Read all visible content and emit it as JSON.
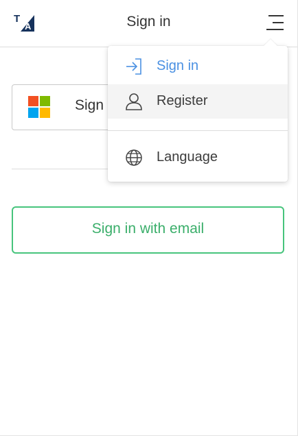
{
  "header": {
    "logo_text": "TA",
    "title": "Sign in",
    "menu_icon": "hamburger-menu-icon"
  },
  "main": {
    "microsoft_button": {
      "label": "Sign",
      "icon": "microsoft-logo-icon",
      "colors": [
        "#f25022",
        "#7fba00",
        "#00a4ef",
        "#ffb900"
      ]
    },
    "email_button": {
      "label": "Sign in with email",
      "color": "#3aae6a"
    }
  },
  "dropdown": {
    "items": [
      {
        "label": "Sign in",
        "icon": "sign-in-arrow-icon",
        "color": "#4a90e2"
      },
      {
        "label": "Register",
        "icon": "user-icon"
      },
      {
        "label": "Language",
        "icon": "globe-icon"
      }
    ]
  }
}
